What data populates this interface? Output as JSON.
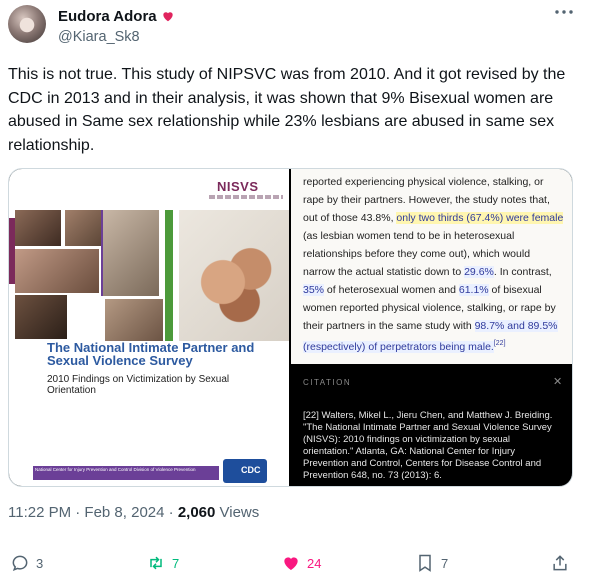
{
  "author": {
    "display_name": "Eudora Adora",
    "handle": "@Kiara_Sk8",
    "badge_icon": "heart-badge-icon"
  },
  "tweet": {
    "text": "This is not true. This study of NIPSVC was from 2010. And it got revised by the CDC in 2013 and in their analysis, it was shown that 9% Bisexual women are abused in Same sex relationship while 23% lesbians are abused in same sex relationship.",
    "timestamp": "11:22 PM · Feb 8, 2024 · ",
    "views": "2,060",
    "views_label": " Views"
  },
  "cover": {
    "logo": "NISVS",
    "title": "The National Intimate Partner and Sexual Violence Survey",
    "subtitle": "2010 Findings on Victimization by Sexual Orientation",
    "footer": "National Center for Injury Prevention and Control Division of Violence Prevention",
    "cdc_logo": "CDC"
  },
  "article": {
    "p1": "reported experiencing physical violence, stalking, or rape by their partners. However, the study notes that, out of those 43.8%, ",
    "h1": "only two thirds (67.4%) were female",
    "p2": " (as lesbian women tend to be in heterosexual relationships before they come out), which would narrow the actual statistic down to ",
    "h2": "29.6%",
    "p3": ". In contrast, ",
    "h3": "35%",
    "p4": " of heterosexual women and ",
    "h4": "61.1%",
    "p5": " of bisexual women reported physical violence, stalking, or rape by their partners in the same study with ",
    "h5": "98.7% and 89.5% (respectively) of perpetrators being male.",
    "ref": "[22]",
    "citation_heading": "CITATION",
    "citation_text": "[22] Walters, Mikel L., Jieru Chen, and Matthew J. Breiding. \"The National Intimate Partner and Sexual Violence Survey (NISVS): 2010 findings on victimization by sexual orientation.\" Atlanta, GA: National Center for Injury Prevention and Control, Centers for Disease Control and Prevention 648, no. 73 (2013): 6."
  },
  "actions": {
    "replies": "3",
    "reposts": "7",
    "likes": "24",
    "bookmarks": "7"
  },
  "colors": {
    "repost": "#00ba7c",
    "like": "#f91880",
    "muted": "#536471"
  }
}
